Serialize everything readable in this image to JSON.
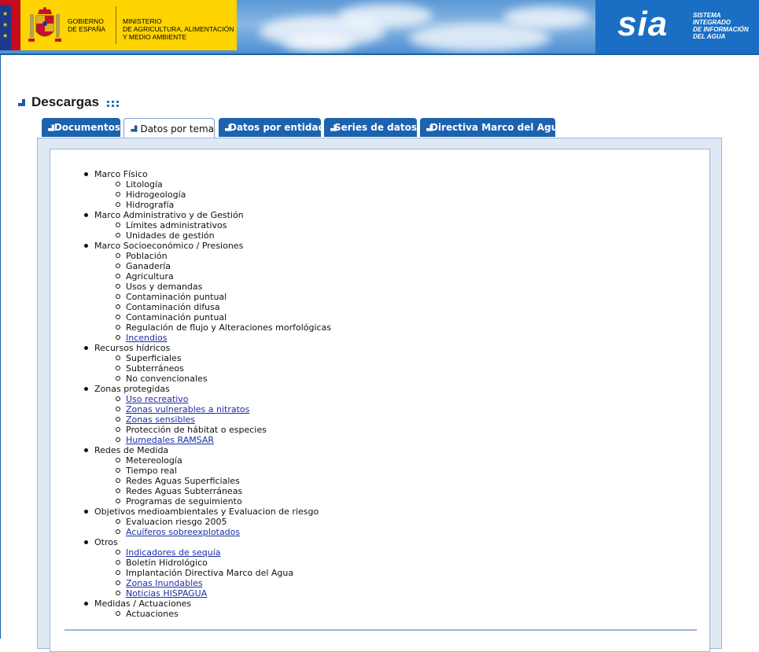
{
  "header": {
    "gov_name": "GOBIERNO\nDE ESPAÑA",
    "ministry_name": "MINISTERIO\nDE AGRICULTURA, ALIMENTACIÓN\nY MEDIO AMBIENTE",
    "sia_logo": "sia",
    "sia_tagline": "SISTEMA\nINTEGRADO\nDE INFORMACIÓN\nDEL AGUA"
  },
  "page": {
    "title": "Descargas"
  },
  "tabs": [
    {
      "label": "Documentos",
      "active": false
    },
    {
      "label": "Datos por tema",
      "active": true
    },
    {
      "label": "Datos por entidad",
      "active": false
    },
    {
      "label": "Series de datos",
      "active": false
    },
    {
      "label": "Directiva Marco del Agua",
      "active": false
    }
  ],
  "categories": [
    {
      "label": "Marco Físico",
      "items": [
        {
          "label": "Litología",
          "link": false
        },
        {
          "label": "Hidrogeología",
          "link": false
        },
        {
          "label": "Hidrografía",
          "link": false
        }
      ]
    },
    {
      "label": "Marco Administrativo y de Gestión",
      "items": [
        {
          "label": "Límites administrativos",
          "link": false
        },
        {
          "label": "Unidades de gestión",
          "link": false
        }
      ]
    },
    {
      "label": "Marco Socioeconómico / Presiones",
      "items": [
        {
          "label": "Población",
          "link": false
        },
        {
          "label": "Ganadería",
          "link": false
        },
        {
          "label": "Agricultura",
          "link": false
        },
        {
          "label": "Usos y demandas",
          "link": false
        },
        {
          "label": "Contaminación puntual",
          "link": false
        },
        {
          "label": "Contaminación difusa",
          "link": false
        },
        {
          "label": "Contaminación puntual",
          "link": false
        },
        {
          "label": "Regulación de flujo y Alteraciones morfológicas",
          "link": false
        },
        {
          "label": "Incendios",
          "link": true
        }
      ]
    },
    {
      "label": "Recursos hídricos",
      "items": [
        {
          "label": "Superficiales",
          "link": false
        },
        {
          "label": "Subterráneos",
          "link": false
        },
        {
          "label": "No convencionales",
          "link": false
        }
      ]
    },
    {
      "label": "Zonas protegidas",
      "items": [
        {
          "label": "Uso recreativo",
          "link": true
        },
        {
          "label": "Zonas vulnerables a nitratos",
          "link": true
        },
        {
          "label": "Zonas sensibles",
          "link": true
        },
        {
          "label": "Protección de hábitat o especies",
          "link": false
        },
        {
          "label": "Humedales RAMSAR",
          "link": true
        }
      ]
    },
    {
      "label": "Redes de Medida",
      "items": [
        {
          "label": "Metereología",
          "link": false
        },
        {
          "label": "Tiempo real",
          "link": false
        },
        {
          "label": "Redes Aguas Superficiales",
          "link": false
        },
        {
          "label": "Redes Aguas Subterráneas",
          "link": false
        },
        {
          "label": "Programas de seguimiento",
          "link": false
        }
      ]
    },
    {
      "label": "Objetivos medioambientales y Evaluacion de riesgo",
      "items": [
        {
          "label": "Evaluacion riesgo 2005",
          "link": false
        },
        {
          "label": "Acuíferos sobreexplotados",
          "link": true
        }
      ]
    },
    {
      "label": "Otros",
      "items": [
        {
          "label": "Indicadores de sequía",
          "link": true
        },
        {
          "label": "Boletín Hidrológico",
          "link": false
        },
        {
          "label": "Implantación Directiva Marco del Agua",
          "link": false
        },
        {
          "label": "Zonas Inundables",
          "link": true
        },
        {
          "label": "Noticias HISPAGUA",
          "link": true
        }
      ]
    },
    {
      "label": "Medidas / Actuaciones",
      "items": [
        {
          "label": "Actuaciones",
          "link": false
        }
      ]
    }
  ],
  "colors": {
    "tab_blue": "#1d62ad",
    "link": "#1c2ea8",
    "gov_yellow": "#ffd400",
    "sia_blue": "#1a6fc4"
  }
}
